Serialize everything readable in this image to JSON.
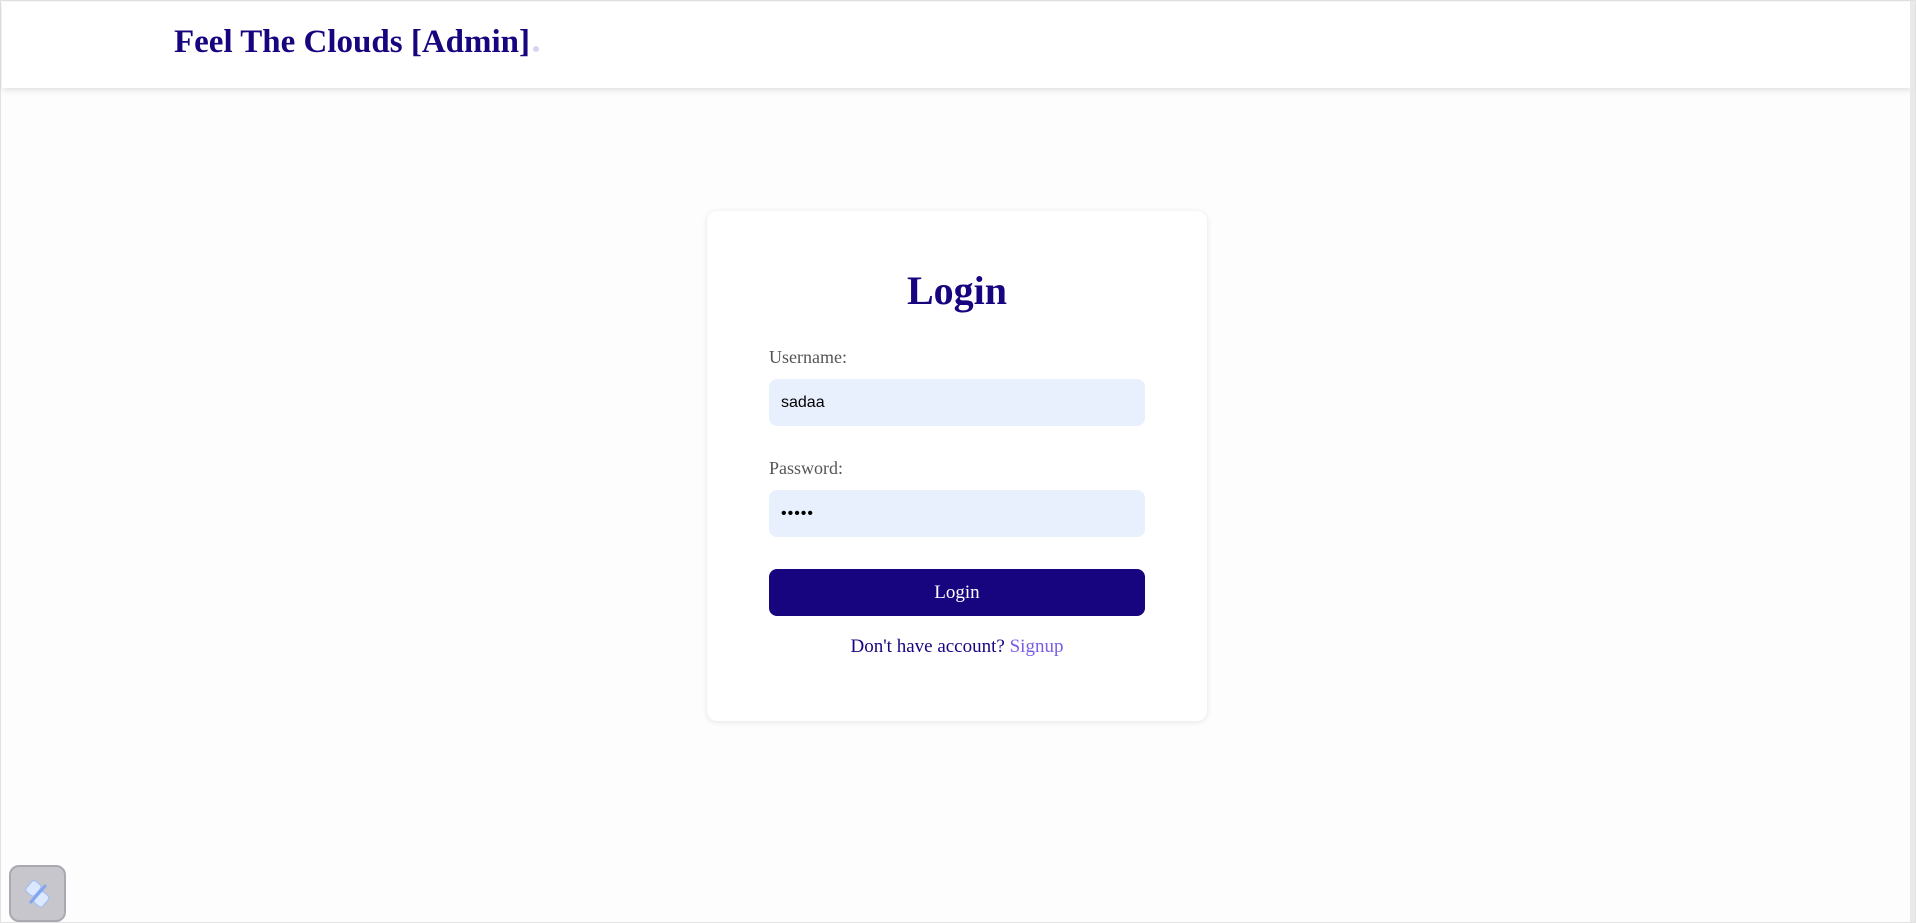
{
  "navbar": {
    "brand": "Feel The Clouds [Admin]"
  },
  "login_card": {
    "title": "Login",
    "username_label": "Username:",
    "username_value": "sadaa",
    "password_label": "Password:",
    "password_value": "•••••",
    "submit_label": "Login",
    "no_account_text": "Don't have account?",
    "signup_link": "Signup"
  },
  "widget": {
    "icon": "lightning-bolt-icon"
  },
  "colors": {
    "brand": "#170580",
    "input_background": "#e8f0fe",
    "link": "#7b5ce6"
  }
}
